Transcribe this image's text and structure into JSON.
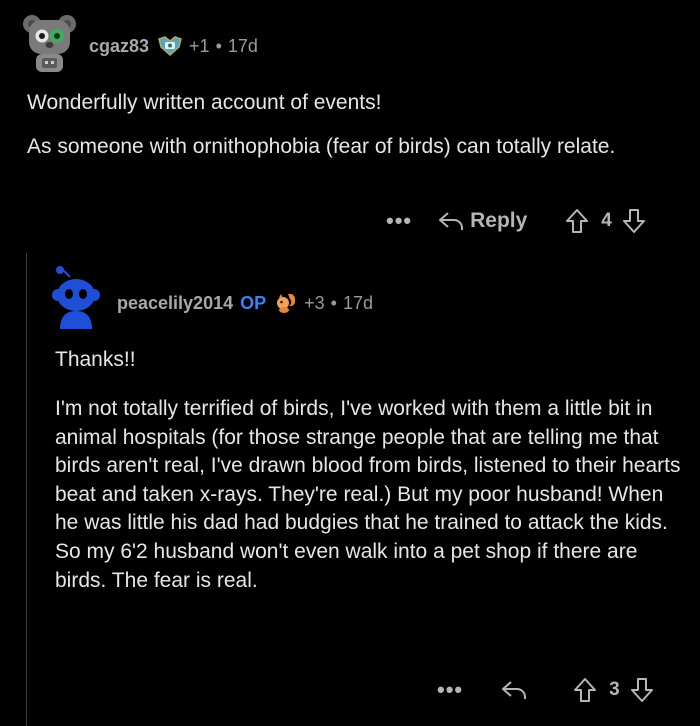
{
  "comments": [
    {
      "username": "cgaz83",
      "op": "",
      "score_delta": "+1",
      "separator": "•",
      "age": "17d",
      "body": [
        "Wonderfully written account of events!",
        "As someone with ornithophobia (fear of birds) can totally relate."
      ],
      "actions": {
        "more": "•••",
        "reply_label": "Reply",
        "score": "4"
      }
    },
    {
      "username": "peacelily2014",
      "op": "OP",
      "score_delta": "+3",
      "separator": "•",
      "age": "17d",
      "body": [
        "Thanks!!",
        "I'm not totally terrified of birds, I've worked with them a little bit in animal hospitals (for those strange people that are telling me that birds aren't real, I've drawn blood from birds, listened to their hearts beat and taken x-rays. They're real.) But my poor husband! When he was little his dad had budgies that he trained to attack the kids. So my 6'2 husband won't even walk into a pet shop if there are birds. The fear is real."
      ],
      "actions": {
        "more": "•••",
        "reply_label": "",
        "score": "3"
      }
    }
  ],
  "icons": {
    "avatar_1": "robot-koala-avatar",
    "flair_1": "achievement-flair-icon",
    "avatar_2": "blue-snoo-avatar",
    "flair_2": "squirrel-flair-icon",
    "reply": "reply-arrow-icon",
    "upvote": "upvote-arrow-icon",
    "downvote": "downvote-arrow-icon"
  },
  "colors": {
    "background": "#000000",
    "op_badge": "#3b82f6",
    "snoo_blue": "#1f4fd6",
    "text": "#e6e6e6",
    "meta": "#9a9a9a"
  }
}
